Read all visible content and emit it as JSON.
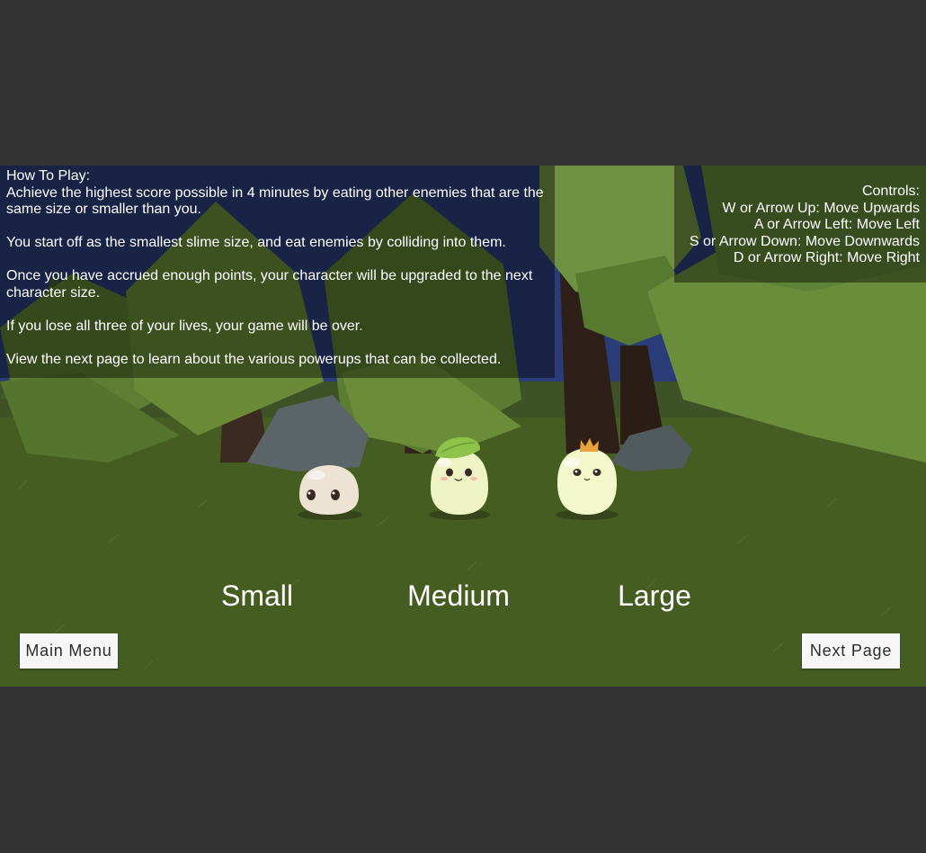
{
  "howto": {
    "title": "How To Play:",
    "p1": "Achieve the highest score possible in 4 minutes by eating other enemies that are the same size or smaller than you.",
    "p2": "You start off as the smallest slime size, and eat enemies by colliding into them.",
    "p3": "Once you have accrued enough points, your character will be upgraded to the next character size.",
    "p4": "If you lose all three of your lives, your game will be over.",
    "p5": "View the next page to learn about the various powerups that can be collected."
  },
  "controls": {
    "title": "Controls:",
    "up": "W or Arrow Up: Move Upwards",
    "left": "A or Arrow Left: Move Left",
    "down": "S or Arrow Down: Move Downwards",
    "right": "D or Arrow Right: Move Right"
  },
  "sizes": {
    "small": "Small",
    "medium": "Medium",
    "large": "Large"
  },
  "buttons": {
    "main_menu": "Main Menu",
    "next_page": "Next Page"
  },
  "colors": {
    "background_letterbox": "#333333",
    "sky": "#2b3f78",
    "grass": "#475f23",
    "tree_foliage": "#5a7d32",
    "tree_trunk": "#2e2018",
    "rock": "#4f5a5e",
    "slime_small": "#ece3d2",
    "slime_medium": "#eef3c4",
    "slime_large": "#f2f7cc",
    "leaf": "#8fc24a",
    "crown": "#e8a23a",
    "button_bg": "#f7f7f7",
    "button_text": "#2c2c2c",
    "text": "#ffffff"
  },
  "characters": [
    {
      "size": "small",
      "accessory": "none"
    },
    {
      "size": "medium",
      "accessory": "leaf"
    },
    {
      "size": "large",
      "accessory": "crown"
    }
  ]
}
